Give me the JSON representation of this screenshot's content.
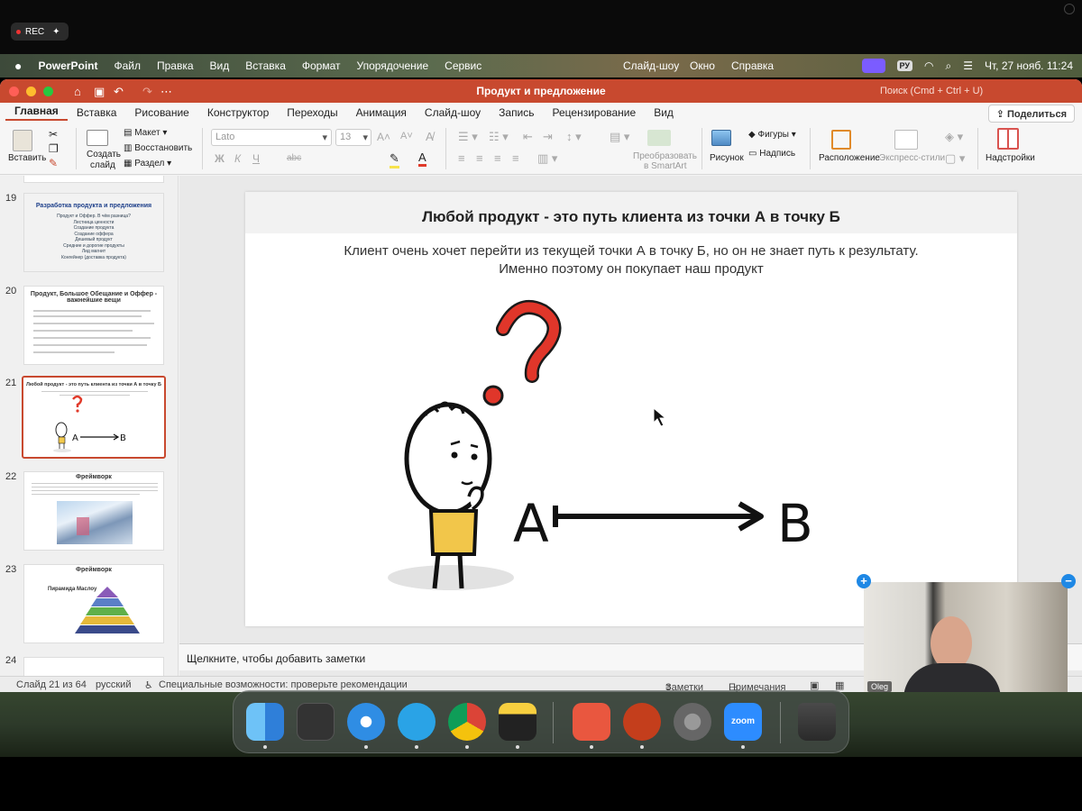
{
  "recording": {
    "label": "REC"
  },
  "menubar": {
    "app_name": "PowerPoint",
    "items": [
      "Файл",
      "Правка",
      "Вид",
      "Вставка",
      "Формат",
      "Упорядочение",
      "Сервис"
    ],
    "right_items": [
      "Слайд-шоу",
      "Окно",
      "Справка"
    ],
    "keyboard_layout": "РУ",
    "datetime": "Чт, 27 нояб.  11:24"
  },
  "window": {
    "title": "Продукт и предложение",
    "search_placeholder": "Поиск (Cmd + Ctrl + U)",
    "accent_color": "#c8492f"
  },
  "ribbon_tabs": [
    "Главная",
    "Вставка",
    "Рисование",
    "Конструктор",
    "Переходы",
    "Анимация",
    "Слайд-шоу",
    "Запись",
    "Рецензирование",
    "Вид"
  ],
  "share_label": "Поделиться",
  "ribbon": {
    "paste": "Вставить",
    "new_slide_line1": "Создать",
    "new_slide_line2": "слайд",
    "layout": "Макет",
    "reset": "Восстановить",
    "section": "Раздел",
    "font_name": "Lato",
    "font_size": "13",
    "smartart_line1": "Преобразовать",
    "smartart_line2": "в SmartArt",
    "picture": "Рисунок",
    "shapes": "Фигуры",
    "textbox": "Надпись",
    "arrange": "Расположение",
    "quick_styles": "Экспресс-стили",
    "addins": "Надстройки",
    "fmt_bold": "Ж",
    "fmt_italic": "К",
    "fmt_underline": "Ч",
    "fmt_strike": "abc"
  },
  "thumbnails": [
    {
      "num": "19",
      "title": "Разработка продукта и предложения",
      "lines": [
        "Продукт и Оффер. В чём разница?",
        "Лестница ценности",
        "Создание продукта",
        "Создание оффера",
        "Дешевый продукт",
        "Средние и дорогие продукты",
        "Лид магнит",
        "Конгейнер (доставка продукта)"
      ]
    },
    {
      "num": "20",
      "title": "Продукт, Большое Обещание и Оффер - важнейшие вещи"
    },
    {
      "num": "21",
      "title": "Любой продукт - это путь клиента из точки А в точку Б"
    },
    {
      "num": "22",
      "title": "Фреймворк"
    },
    {
      "num": "23",
      "title": "Фреймворк",
      "subtitle": "Пирамида Маслоу"
    },
    {
      "num": "24"
    }
  ],
  "slide": {
    "title": "Любой продукт - это путь клиента из точки А в точку Б",
    "subtitle_line1": "Клиент очень хочет перейти из текущей точки А в точку Б, но он не знает путь к результату.",
    "subtitle_line2": "Именно поэтому он покупает наш продукт",
    "point_a": "A",
    "point_b": "B"
  },
  "notes_placeholder": "Щелкните, чтобы добавить заметки",
  "statusbar": {
    "slide_counter": "Слайд 21 из 64",
    "language": "русский",
    "accessibility": "Специальные возможности: проверьте рекомендации",
    "notes": "Заметки",
    "comments": "Примечания"
  },
  "video": {
    "participant": "Oleg"
  },
  "dock": [
    "Finder",
    "Launchpad",
    "Safari",
    "Telegram",
    "Chrome",
    "Notes",
    "Spark",
    "PowerPoint",
    "System Settings",
    "Zoom",
    "Trash"
  ],
  "dock_zoom_label": "zoom"
}
